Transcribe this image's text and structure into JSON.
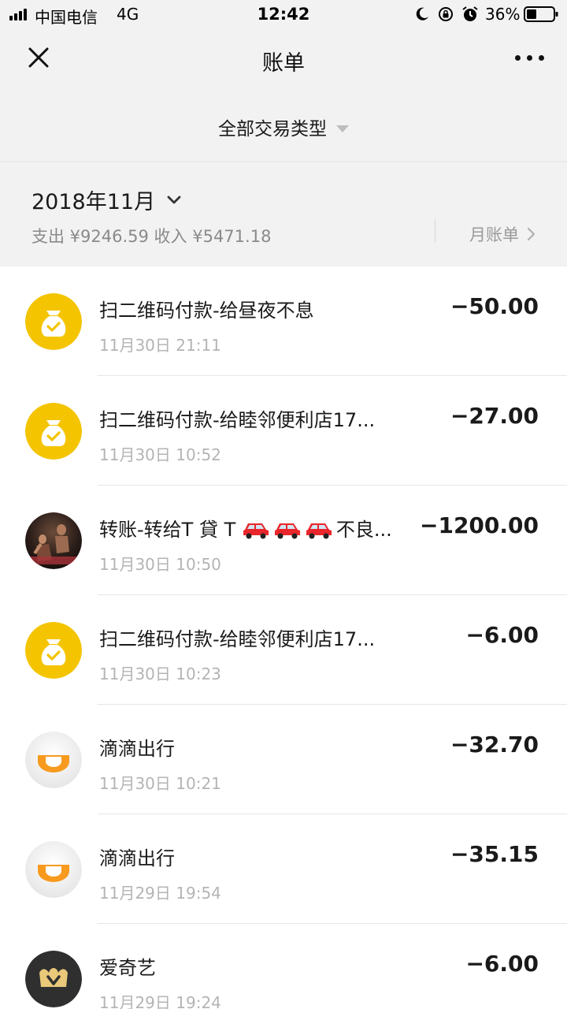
{
  "status_bar": {
    "carrier": "中国电信",
    "network": "4G",
    "time": "12:42",
    "battery_percent": "36%",
    "battery_level": 0.36,
    "icons": [
      "signal-icon",
      "moon-icon",
      "rotation-lock-icon",
      "alarm-icon",
      "battery-icon"
    ]
  },
  "header": {
    "title": "账单",
    "close_icon": "close-icon",
    "more_icon": "more-dots-icon"
  },
  "filter": {
    "label": "全部交易类型",
    "icon": "caret-down-icon"
  },
  "month": {
    "label": "2018年11月",
    "summary": "支出 ¥9246.59 收入 ¥5471.18",
    "monthly_bill_label": "月账单",
    "chevron_icon": "chevron-down-icon",
    "arrow_icon": "chevron-right-icon"
  },
  "transactions": [
    {
      "title": "扫二维码付款-给昼夜不息",
      "time": "11月30日 21:11",
      "amount": "−50.00",
      "icon": "money-bag-icon"
    },
    {
      "title": "扫二维码付款-给睦邻便利店17...",
      "time": "11月30日 10:52",
      "amount": "−27.00",
      "icon": "money-bag-icon"
    },
    {
      "title_prefix": "转账-转给T 貸 T",
      "title_suffix": "不良...",
      "time": "11月30日 10:50",
      "amount": "−1200.00",
      "icon": "user-photo-avatar",
      "emoji_icon": "car-icon"
    },
    {
      "title": "扫二维码付款-给睦邻便利店17...",
      "time": "11月30日 10:23",
      "amount": "−6.00",
      "icon": "money-bag-icon"
    },
    {
      "title": "滴滴出行",
      "time": "11月30日 10:21",
      "amount": "−32.70",
      "icon": "didi-logo-icon"
    },
    {
      "title": "滴滴出行",
      "time": "11月29日 19:54",
      "amount": "−35.15",
      "icon": "didi-logo-icon"
    },
    {
      "title": "爱奇艺",
      "time": "11月29日 19:24",
      "amount": "−6.00",
      "icon": "iqiyi-vip-crown-icon"
    }
  ],
  "colors": {
    "header_bg": "#f2f2f2",
    "list_bg": "#ffffff",
    "money_bag_yellow": "#f4c400",
    "didi_orange": "#f79a1e",
    "car_red": "#e8262b",
    "secondary_text": "#b4b4b4"
  }
}
